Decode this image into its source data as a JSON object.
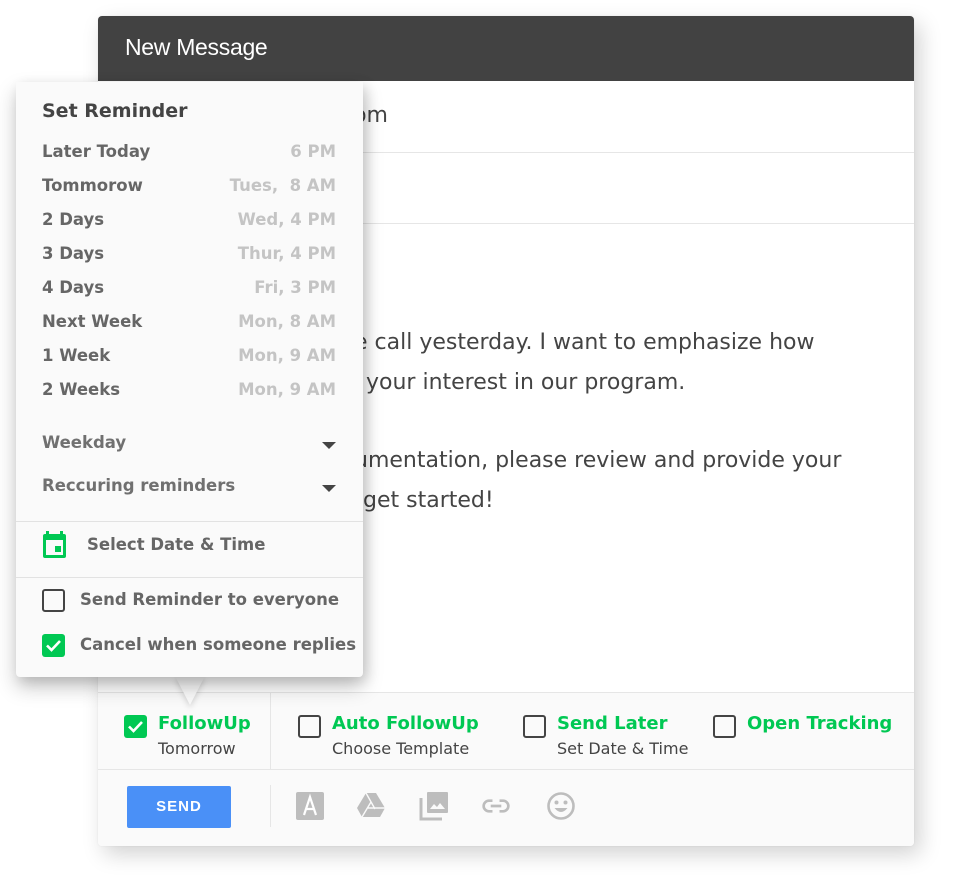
{
  "compose": {
    "title": "New Message",
    "to_value": ".com",
    "subject_value": "",
    "body_lines": [
      "e call yesterday. I want to emphasize how",
      "your interest in our program.",
      "",
      "umentation, please review and provide your",
      "get started!"
    ]
  },
  "options": [
    {
      "label": "FollowUp",
      "sublabel": "Tomorrow",
      "checked": true
    },
    {
      "label": "Auto FollowUp",
      "sublabel": "Choose Template",
      "checked": false
    },
    {
      "label": "Send Later",
      "sublabel": "Set Date & Time",
      "checked": false
    },
    {
      "label": "Open Tracking",
      "sublabel": "",
      "checked": false
    }
  ],
  "toolbar": {
    "send_label": "SEND",
    "icons": [
      "text-format-icon",
      "google-drive-icon",
      "photo-icon",
      "link-icon",
      "emoji-icon"
    ]
  },
  "reminder": {
    "title": "Set Reminder",
    "items": [
      {
        "label": "Later Today",
        "time": "6 PM"
      },
      {
        "label": "Tommorow",
        "time": "Tues,  8 AM"
      },
      {
        "label": "2 Days",
        "time": "Wed, 4 PM"
      },
      {
        "label": "3 Days",
        "time": "Thur, 4 PM"
      },
      {
        "label": "4 Days",
        "time": "Fri, 3 PM"
      },
      {
        "label": "Next Week",
        "time": "Mon, 8 AM"
      },
      {
        "label": "1 Week",
        "time": "Mon, 9 AM"
      },
      {
        "label": "2 Weeks",
        "time": "Mon, 9 AM"
      }
    ],
    "dropdowns": [
      {
        "label": "Weekday"
      },
      {
        "label": "Reccuring reminders"
      }
    ],
    "select_date_label": "Select Date & Time",
    "checkboxes": [
      {
        "label": "Send Reminder to everyone",
        "checked": false
      },
      {
        "label": "Cancel when someone replies",
        "checked": true
      }
    ]
  },
  "colors": {
    "accent_green": "#00c853",
    "send_blue": "#4a90f7",
    "header_dark": "#424242"
  }
}
